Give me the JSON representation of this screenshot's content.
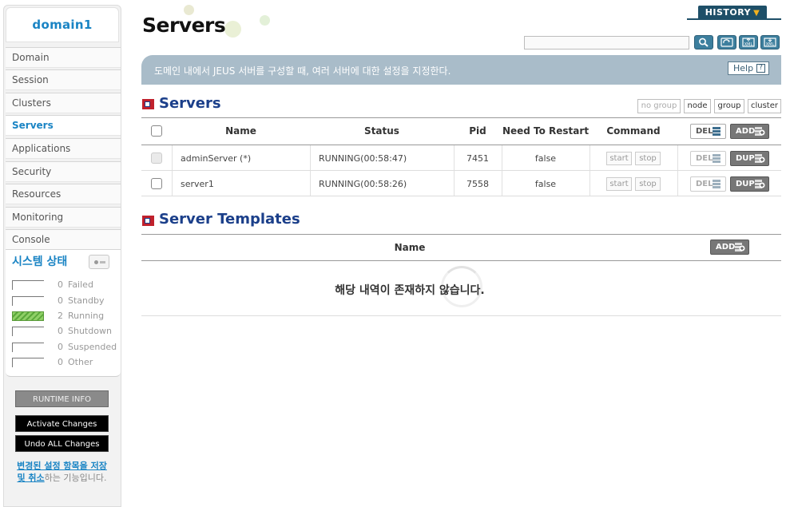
{
  "sidebar": {
    "domain": "domain1",
    "items": [
      {
        "label": "Domain"
      },
      {
        "label": "Session"
      },
      {
        "label": "Clusters"
      },
      {
        "label": "Servers"
      },
      {
        "label": "Applications"
      },
      {
        "label": "Security"
      },
      {
        "label": "Resources"
      },
      {
        "label": "Monitoring"
      },
      {
        "label": "Console"
      }
    ],
    "active_item": "Servers",
    "status": {
      "title": "시스템 상태",
      "rows": [
        {
          "count": "0",
          "label": "Failed",
          "fill": 0
        },
        {
          "count": "0",
          "label": "Standby",
          "fill": 0
        },
        {
          "count": "2",
          "label": "Running",
          "fill": 1
        },
        {
          "count": "0",
          "label": "Shutdown",
          "fill": 0
        },
        {
          "count": "0",
          "label": "Suspended",
          "fill": 0
        },
        {
          "count": "0",
          "label": "Other",
          "fill": 0
        }
      ]
    },
    "buttons": {
      "runtime": "RUNTIME INFO",
      "activate": "Activate Changes",
      "undo": "Undo ALL Changes"
    },
    "note": {
      "link": "변경된 설정 항목을 저장 및 취소",
      "rest": "하는 기능입니다."
    }
  },
  "header": {
    "title": "Servers",
    "history": "HISTORY",
    "search_value": "",
    "tools": [
      "search-icon",
      "refresh-icon",
      "xml-export-icon",
      "xml-import-icon"
    ]
  },
  "description": {
    "text": "도메인 내에서 JEUS 서버를 구성할 때, 여러 서버에 대한 설정을 지정한다.",
    "help": "Help",
    "help_q": "?"
  },
  "servers": {
    "title": "Servers",
    "filters": [
      "no group",
      "node",
      "group",
      "cluster"
    ],
    "columns": {
      "name": "Name",
      "status": "Status",
      "pid": "Pid",
      "restart": "Need To Restart",
      "command": "Command"
    },
    "header_buttons": {
      "del": "DEL",
      "add": "ADD"
    },
    "rows": [
      {
        "name": "adminServer (*)",
        "status": "RUNNING(00:58:47)",
        "pid": "7451",
        "restart": "false",
        "start": "start",
        "stop": "stop",
        "del": "DEL",
        "dup": "DUP"
      },
      {
        "name": "server1",
        "status": "RUNNING(00:58:26)",
        "pid": "7558",
        "restart": "false",
        "start": "start",
        "stop": "stop",
        "del": "DEL",
        "dup": "DUP"
      }
    ]
  },
  "templates": {
    "title": "Server Templates",
    "columns": {
      "name": "Name"
    },
    "add": "ADD",
    "empty": "해당 내역이 존재하지 않습니다."
  },
  "colors": {
    "accent": "#1a84c4",
    "navy": "#1b3f8a",
    "history": "#1e4f68",
    "desc_bar": "#a9bcc9"
  }
}
